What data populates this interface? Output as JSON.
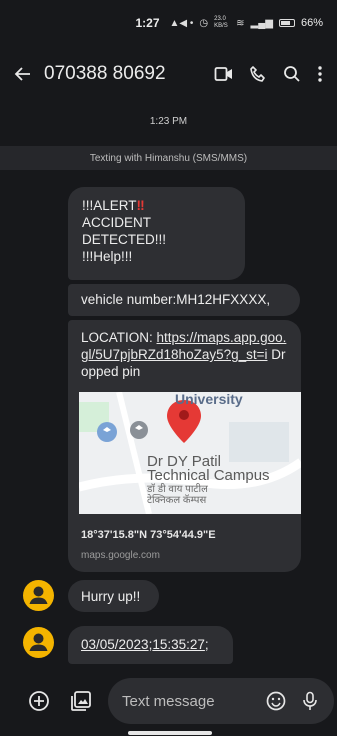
{
  "status_bar": {
    "time": "1:27",
    "data_speed": "23.0 KB/S",
    "battery": "66%"
  },
  "header": {
    "phone_number": "070388 80692"
  },
  "conversation": {
    "date_stamp": "1:23 PM",
    "banner": "Texting with Himanshu (SMS/MMS)",
    "alert": {
      "line1": "!!!ALERT",
      "mark": "‼",
      "line2": "ACCIDENT DETECTED!!!",
      "line3": "!!!Help!!!"
    },
    "vehicle": "vehicle number:MH12HFXXXX,",
    "location": {
      "prefix": "LOCATION: ",
      "url": "https://maps.app.goo.gl/5U7pjbRZd18hoZay5?g_st=i",
      "suffix": " Dropped pin",
      "map_label_top": "University",
      "map_label_l1": "Dr DY Patil",
      "map_label_l2": "Technical Campus",
      "map_label_hi1": "डॉ डी वाय पाटील",
      "map_label_hi2": "टेक्निकल कॅम्पस",
      "coords": "18°37'15.8\"N 73°54'44.9\"E",
      "domain": "maps.google.com"
    },
    "hurry": "Hurry up!!",
    "timestamp_msg": {
      "date": "03/05/2023",
      "sep": ";",
      "time": "15:35:27",
      "tail": ";"
    }
  },
  "composer": {
    "placeholder": "Text message"
  },
  "colors": {
    "background": "#17181b",
    "bubble": "#2e2f33",
    "avatar": "#f4b400",
    "alert_red": "#e53935"
  }
}
